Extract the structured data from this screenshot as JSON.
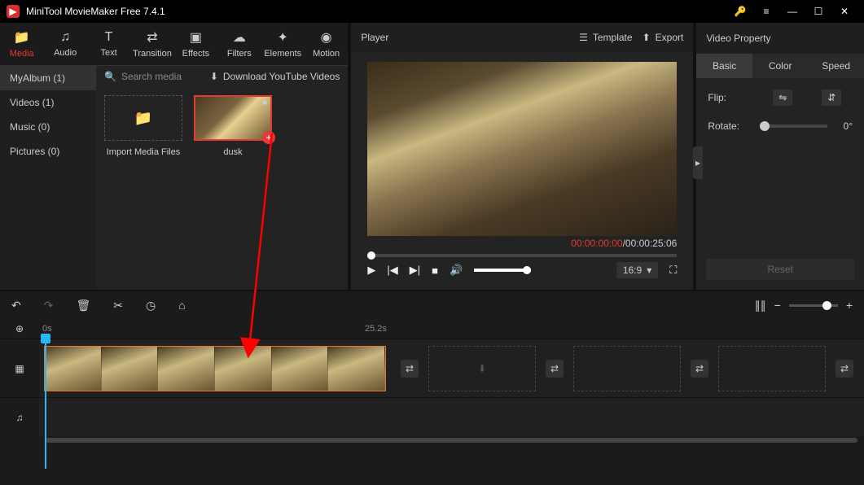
{
  "app": {
    "title": "MiniTool MovieMaker Free 7.4.1"
  },
  "toolbar": {
    "media": "Media",
    "audio": "Audio",
    "text": "Text",
    "transition": "Transition",
    "effects": "Effects",
    "filters": "Filters",
    "elements": "Elements",
    "motion": "Motion"
  },
  "library": {
    "myalbum": "MyAlbum (1)",
    "videos": "Videos (1)",
    "music": "Music (0)",
    "pictures": "Pictures (0)",
    "search_placeholder": "Search media",
    "download": "Download YouTube Videos",
    "import_label": "Import Media Files",
    "clip1_name": "dusk"
  },
  "player": {
    "label": "Player",
    "template": "Template",
    "export": "Export",
    "time_current": "00:00:00:00",
    "time_sep": " / ",
    "time_total": "00:00:25:06",
    "aspect": "16:9"
  },
  "property": {
    "title": "Video Property",
    "tab_basic": "Basic",
    "tab_color": "Color",
    "tab_speed": "Speed",
    "flip": "Flip:",
    "rotate": "Rotate:",
    "rotate_val": "0°",
    "reset": "Reset"
  },
  "timeline": {
    "ruler_start": "0s",
    "ruler_mid": "25.2s"
  }
}
